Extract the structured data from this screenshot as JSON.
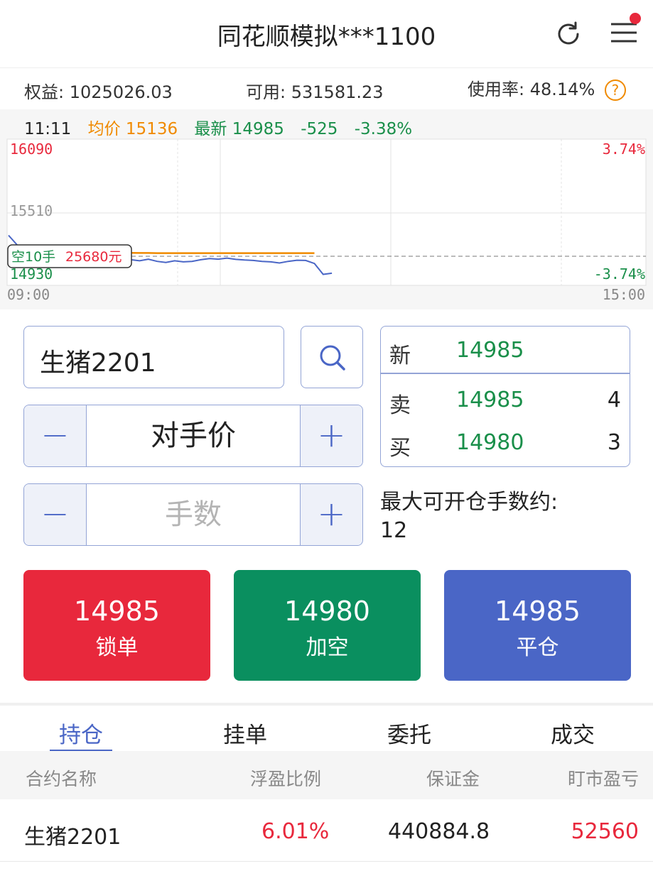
{
  "header": {
    "title": "同花顺模拟***1100"
  },
  "account": {
    "equity_label": "权益:",
    "equity_value": "1025026.03",
    "available_label": "可用:",
    "available_value": "531581.23",
    "usage_label": "使用率:",
    "usage_value": "48.14%",
    "help_glyph": "?"
  },
  "chart_data": {
    "type": "line",
    "time": "11:11",
    "avg_label": "均价",
    "avg_value": "15136",
    "latest_label": "最新",
    "latest_value": "14985",
    "change": "-525",
    "change_pct": "-3.38%",
    "ylim": [
      14930,
      16090
    ],
    "y_ticks": [
      "16090",
      "15510",
      "14930"
    ],
    "pct_high": "3.74%",
    "pct_low": "-3.74%",
    "x_start": "09:00",
    "x_end": "15:00",
    "position_tag": {
      "side": "空10手",
      "amount": "25680元"
    },
    "series": [
      {
        "color": "#4a66c6",
        "values": [
          15300,
          15210,
          15180,
          15120,
          15130,
          15120,
          15115,
          15110,
          15105,
          15100,
          15095,
          15085,
          15070,
          15080,
          15075,
          15065,
          15080,
          15060,
          15050,
          15065,
          15055,
          15060,
          15075,
          15085,
          15080,
          15090,
          15078,
          15072,
          15068,
          15060,
          15055,
          15045,
          15060,
          15070,
          15068,
          15040,
          14940,
          14950
        ]
      },
      {
        "color": "#f08a00",
        "values": [
          15180,
          15165,
          15158,
          15152,
          15150,
          15148,
          15146,
          15145,
          15144,
          15143,
          15142,
          15141,
          15140,
          15139,
          15138,
          15137,
          15137,
          15136,
          15136,
          15136,
          15136,
          15136,
          15136,
          15136,
          15136,
          15136,
          15136,
          15136,
          15136,
          15136,
          15136,
          15136,
          15136,
          15136,
          15136,
          15136
        ]
      }
    ]
  },
  "order": {
    "contract": "生猪2201",
    "price_mode": "对手价",
    "qty_placeholder": "手数",
    "minus": "−",
    "plus": "+"
  },
  "quote": {
    "new_label": "新",
    "new_price": "14985",
    "sell_label": "卖",
    "sell_price": "14985",
    "sell_qty": "4",
    "buy_label": "买",
    "buy_price": "14980",
    "buy_qty": "3"
  },
  "max_open": {
    "label": "最大可开仓手数约:",
    "value": "12"
  },
  "actions": {
    "lock": {
      "price": "14985",
      "label": "锁单",
      "color": "#e8283c"
    },
    "short": {
      "price": "14980",
      "label": "加空",
      "color": "#0a8f5f"
    },
    "close": {
      "price": "14985",
      "label": "平仓",
      "color": "#4a66c6"
    }
  },
  "tabs": [
    "持仓",
    "挂单",
    "委托",
    "成交"
  ],
  "table": {
    "headers": [
      "合约名称",
      "浮盈比例",
      "保证金",
      "盯市盈亏"
    ],
    "rows": [
      {
        "name": "生猪2201",
        "ratio": "6.01%",
        "margin": "440884.8",
        "pnl": "52560"
      }
    ]
  }
}
